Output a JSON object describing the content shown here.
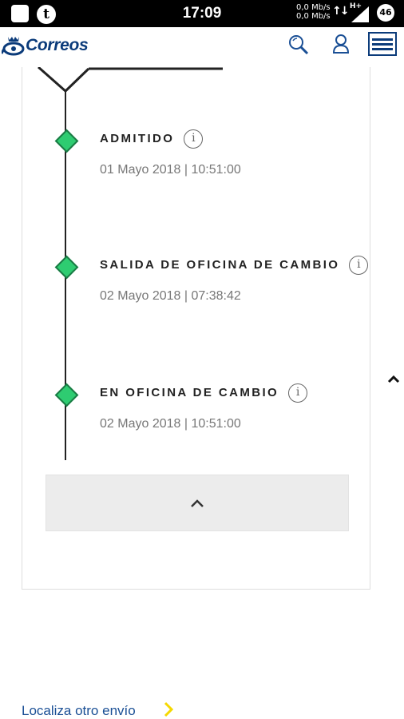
{
  "status_bar": {
    "time": "17:09",
    "data_up": "0,0 Mb/s",
    "data_down": "0,0 Mb/s",
    "network": "H+",
    "battery": "46",
    "notification_icon": "t"
  },
  "header": {
    "brand": "Correos",
    "icons": [
      "posthorn-crown-icon",
      "search-icon",
      "user-icon",
      "menu-icon"
    ]
  },
  "tracking": {
    "events": [
      {
        "title": "ADMITIDO",
        "date": "01 Mayo 2018 | 10:51:00"
      },
      {
        "title": "SALIDA DE OFICINA DE CAMBIO",
        "date": "02 Mayo 2018 | 07:38:42"
      },
      {
        "title": "EN OFICINA DE CAMBIO",
        "date": "02 Mayo 2018 | 10:51:00"
      }
    ],
    "info_glyph": "i",
    "diamond_color": "#2ecc71"
  },
  "footer": {
    "localiza_link": "Localiza otro envío"
  },
  "colors": {
    "brand_blue": "#0b3b7a",
    "link_blue": "#1a4f95",
    "arrow_yellow": "#f5d800"
  }
}
